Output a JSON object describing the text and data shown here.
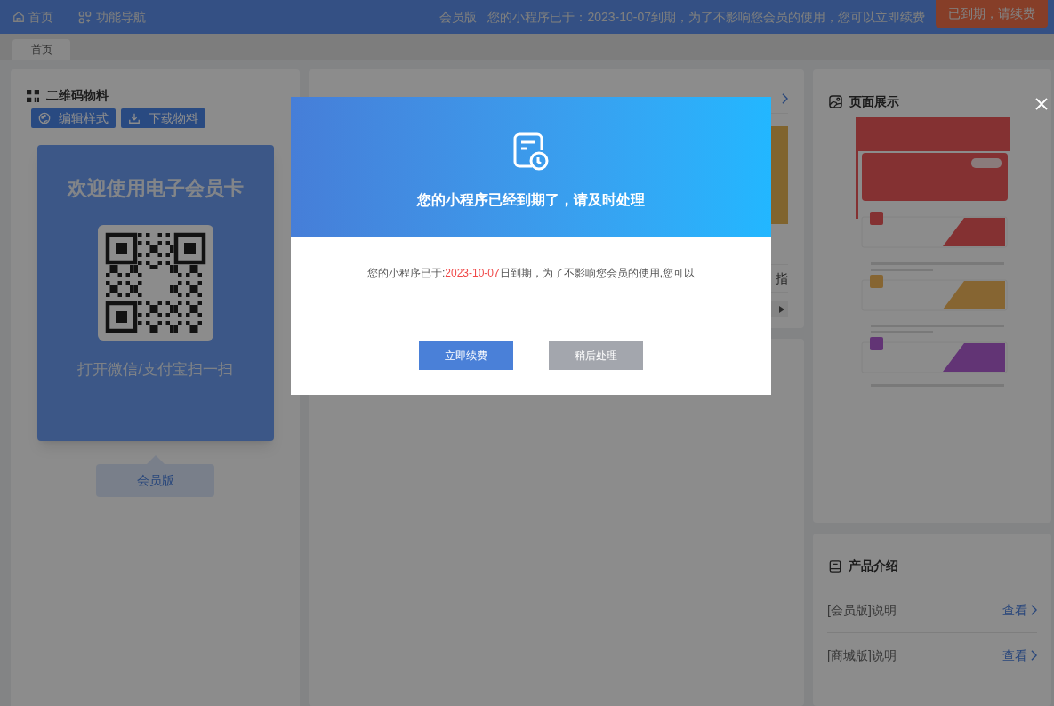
{
  "top_bar": {
    "home": "首页",
    "nav": "功能导航",
    "edition": "会员版",
    "notice": "您的小程序已于：2023-10-07到期，为了不影响您会员的使用，您可以立即续费",
    "renew_button": "已到期，请续费"
  },
  "tabs": [
    {
      "label": "首页",
      "selected": true
    }
  ],
  "qr_panel": {
    "title": "二维码物料",
    "buttons": [
      "编辑样式",
      "下载物料"
    ],
    "card_title": "欢迎使用电子会员卡",
    "card_caption": "打开微信/支付宝扫一扫",
    "versions": [
      {
        "label": "会员版",
        "selected": true
      }
    ]
  },
  "activity_panel": {
    "cut_text": "指"
  },
  "preview_panel": {
    "title": "页面展示"
  },
  "product_panel": {
    "title": "产品介绍",
    "rows": [
      {
        "label": "[会员版]说明",
        "link": "查看"
      },
      {
        "label": "[商城版]说明",
        "link": "查看"
      }
    ]
  },
  "dialog": {
    "heading": "您的小程序已经到期了，请及时处理",
    "message_before": "您的小程序已于:",
    "date": "2023-10-07",
    "message_after": "日到期，为了不影响您会员的使用,您可以",
    "buttons": [
      {
        "label": "立即续费",
        "kind": "primary"
      },
      {
        "label": "稍后处理",
        "kind": "secondary"
      }
    ]
  }
}
